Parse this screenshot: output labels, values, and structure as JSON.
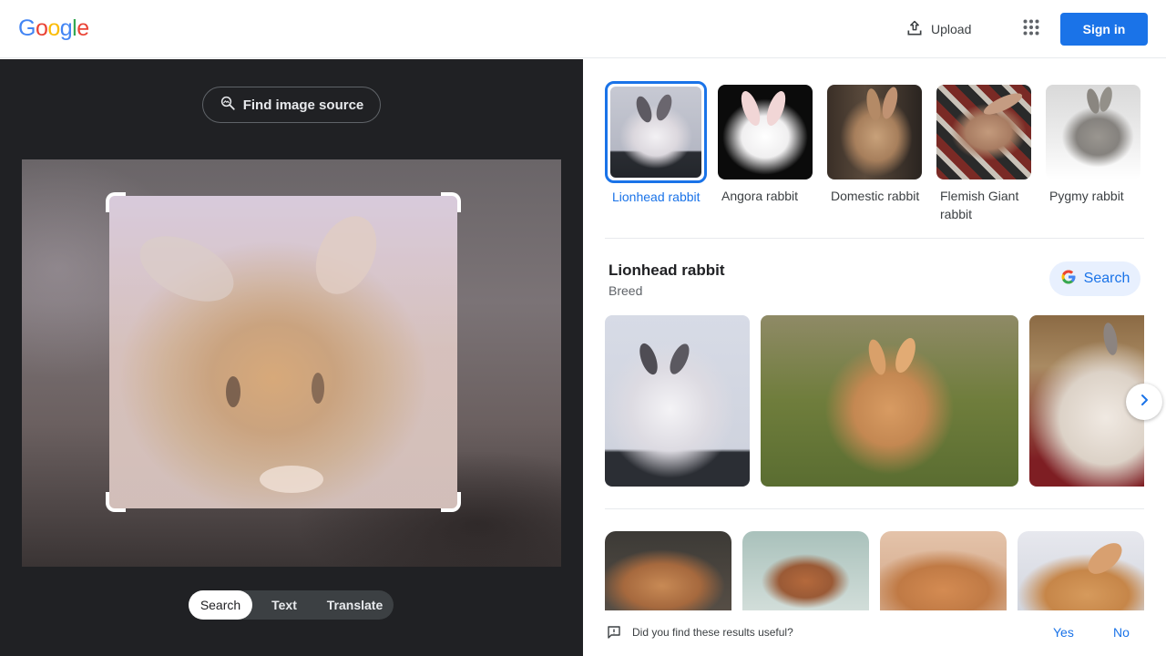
{
  "header": {
    "logo_letters": [
      {
        "char": "G",
        "color": "#4285f4"
      },
      {
        "char": "o",
        "color": "#ea4335"
      },
      {
        "char": "o",
        "color": "#fbbc05"
      },
      {
        "char": "g",
        "color": "#4285f4"
      },
      {
        "char": "l",
        "color": "#34a853"
      },
      {
        "char": "e",
        "color": "#ea4335"
      }
    ],
    "upload_label": "Upload",
    "apps_icon": "apps-grid-icon",
    "signin_label": "Sign in"
  },
  "left_panel": {
    "find_source_label": "Find image source",
    "modes": [
      "Search",
      "Text",
      "Translate"
    ],
    "active_mode": "Search"
  },
  "right_panel": {
    "related": [
      {
        "label": "Lionhead rabbit",
        "selected": true
      },
      {
        "label": "Angora rabbit",
        "selected": false
      },
      {
        "label": "Domestic rabbit",
        "selected": false
      },
      {
        "label": "Flemish Giant rabbit",
        "selected": false
      },
      {
        "label": "Pygmy rabbit",
        "selected": false
      }
    ],
    "knowledge": {
      "title": "Lionhead rabbit",
      "subtitle": "Breed",
      "search_label": "Search"
    },
    "feedback": {
      "question": "Did you find these results useful?",
      "yes": "Yes",
      "no": "No"
    }
  },
  "colors": {
    "accent": "#1a73e8",
    "dark_bg": "#202124"
  }
}
